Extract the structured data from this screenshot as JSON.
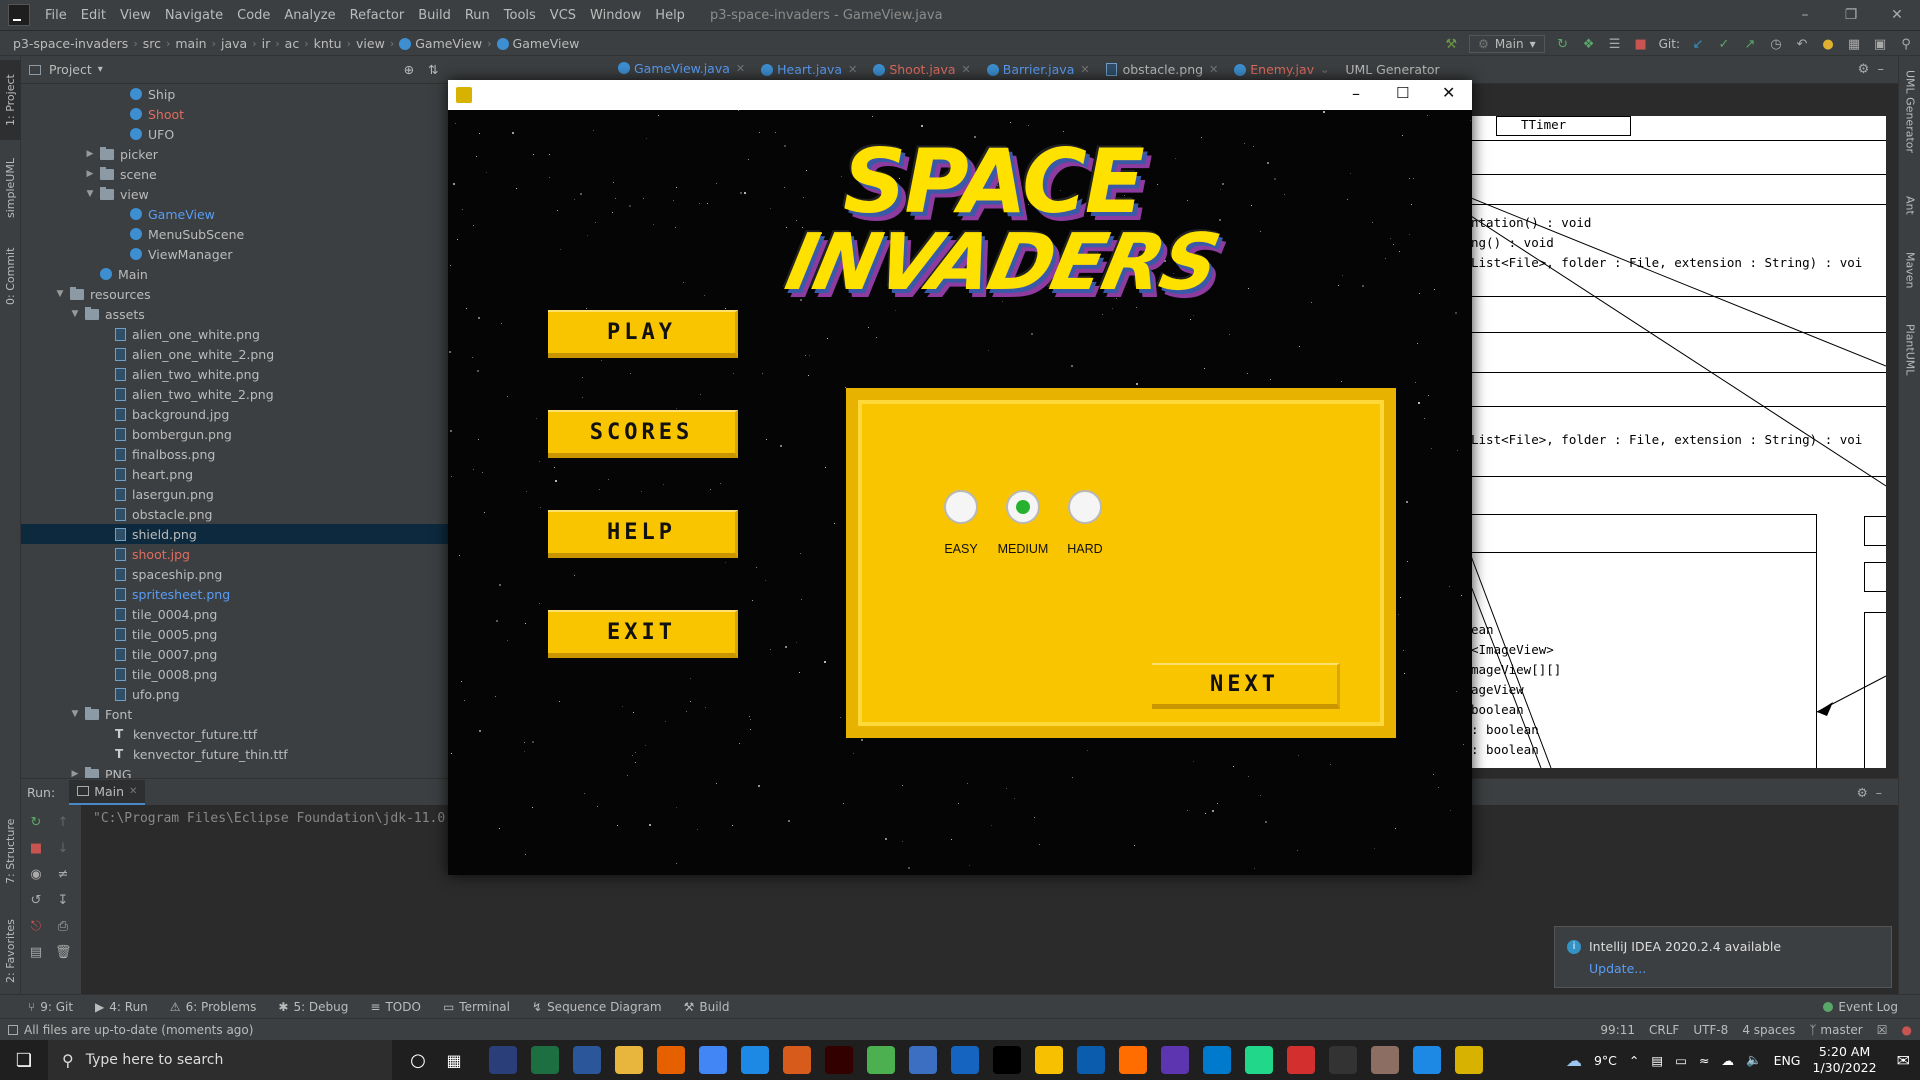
{
  "ide": {
    "menu": [
      "File",
      "Edit",
      "View",
      "Navigate",
      "Code",
      "Analyze",
      "Refactor",
      "Build",
      "Run",
      "Tools",
      "VCS",
      "Window",
      "Help"
    ],
    "window_title": "p3-space-invaders - GameView.java",
    "breadcrumbs": [
      "p3-space-invaders",
      "src",
      "main",
      "java",
      "ir",
      "ac",
      "kntu",
      "view",
      "GameView",
      "GameView"
    ],
    "run_config": "Main",
    "git_label": "Git:",
    "project_view": "Project",
    "tabs": [
      {
        "label": "GameView.java",
        "color": "#589df6"
      },
      {
        "label": "Heart.java",
        "color": "#589df6"
      },
      {
        "label": "Shoot.java",
        "color": "#e06c5f"
      },
      {
        "label": "Barrier.java",
        "color": "#589df6"
      },
      {
        "label": "obstacle.png",
        "color": "#bbbbbb"
      },
      {
        "label": "Enemy.jav",
        "color": "#e06c5f"
      },
      {
        "label": "UML Generator",
        "color": "#bbbbbb"
      }
    ],
    "left_tabs": [
      "1: Project",
      "simpleUML",
      "0: Commit",
      "7: Structure",
      "2: Favorites"
    ],
    "right_tabs": [
      "UML Generator",
      "Ant",
      "Maven",
      "PlantUML"
    ],
    "tree": [
      {
        "label": "Ship",
        "indent": 7,
        "kind": "class"
      },
      {
        "label": "Shoot",
        "indent": 7,
        "kind": "class",
        "color": "red"
      },
      {
        "label": "UFO",
        "indent": 7,
        "kind": "class"
      },
      {
        "label": "picker",
        "indent": 5,
        "kind": "folder",
        "arrow": "▶"
      },
      {
        "label": "scene",
        "indent": 5,
        "kind": "folder",
        "arrow": "▶"
      },
      {
        "label": "view",
        "indent": 5,
        "kind": "folder",
        "arrow": "▼"
      },
      {
        "label": "GameView",
        "indent": 7,
        "kind": "class",
        "color": "blue"
      },
      {
        "label": "MenuSubScene",
        "indent": 7,
        "kind": "class"
      },
      {
        "label": "ViewManager",
        "indent": 7,
        "kind": "class"
      },
      {
        "label": "Main",
        "indent": 5,
        "kind": "class"
      },
      {
        "label": "resources",
        "indent": 3,
        "kind": "folder",
        "arrow": "▼"
      },
      {
        "label": "assets",
        "indent": 4,
        "kind": "folder",
        "arrow": "▼"
      },
      {
        "label": "alien_one_white.png",
        "indent": 6,
        "kind": "file"
      },
      {
        "label": "alien_one_white_2.png",
        "indent": 6,
        "kind": "file"
      },
      {
        "label": "alien_two_white.png",
        "indent": 6,
        "kind": "file"
      },
      {
        "label": "alien_two_white_2.png",
        "indent": 6,
        "kind": "file"
      },
      {
        "label": "background.jpg",
        "indent": 6,
        "kind": "file"
      },
      {
        "label": "bombergun.png",
        "indent": 6,
        "kind": "file"
      },
      {
        "label": "finalboss.png",
        "indent": 6,
        "kind": "file"
      },
      {
        "label": "heart.png",
        "indent": 6,
        "kind": "file"
      },
      {
        "label": "lasergun.png",
        "indent": 6,
        "kind": "file"
      },
      {
        "label": "obstacle.png",
        "indent": 6,
        "kind": "file"
      },
      {
        "label": "shield.png",
        "indent": 6,
        "kind": "file",
        "selected": true
      },
      {
        "label": "shoot.jpg",
        "indent": 6,
        "kind": "file",
        "color": "red"
      },
      {
        "label": "spaceship.png",
        "indent": 6,
        "kind": "file"
      },
      {
        "label": "spritesheet.png",
        "indent": 6,
        "kind": "file",
        "color": "blue"
      },
      {
        "label": "tile_0004.png",
        "indent": 6,
        "kind": "file"
      },
      {
        "label": "tile_0005.png",
        "indent": 6,
        "kind": "file"
      },
      {
        "label": "tile_0007.png",
        "indent": 6,
        "kind": "file"
      },
      {
        "label": "tile_0008.png",
        "indent": 6,
        "kind": "file"
      },
      {
        "label": "ufo.png",
        "indent": 6,
        "kind": "file"
      },
      {
        "label": "Font",
        "indent": 4,
        "kind": "folder",
        "arrow": "▼"
      },
      {
        "label": "kenvector_future.ttf",
        "indent": 6,
        "kind": "font"
      },
      {
        "label": "kenvector_future_thin.ttf",
        "indent": 6,
        "kind": "font"
      },
      {
        "label": "PNG",
        "indent": 4,
        "kind": "folder",
        "arrow": "▶"
      }
    ],
    "uml_lines": [
      "TTimer",
      "ntation() : void",
      "ng() : void",
      "List<File>, folder : File, extension : String) : voi",
      "List<File>, folder : File, extension : String) : voi",
      "ean",
      "<ImageView>",
      "mageView[][]",
      "ageView",
      " boolean",
      ": boolean",
      " : boolean"
    ],
    "run": {
      "label": "Run:",
      "tab": "Main",
      "command": "\"C:\\Program Files\\Eclipse Foundation\\jdk-11.0"
    },
    "bottom_tools": [
      "9: Git",
      "4: Run",
      "6: Problems",
      "5: Debug",
      "TODO",
      "Terminal",
      "Sequence Diagram",
      "Build"
    ],
    "event_log": "Event Log",
    "status_left": "All files are up-to-date (moments ago)",
    "status_right": [
      "99:11",
      "CRLF",
      "UTF-8",
      "4 spaces",
      "master"
    ],
    "notification": {
      "title": "IntelliJ IDEA 2020.2.4 available",
      "link": "Update..."
    }
  },
  "game": {
    "logo_line1": "SPACE",
    "logo_line2": "INVADERS",
    "buttons": [
      "PLAY",
      "SCORES",
      "HELP",
      "EXIT"
    ],
    "difficulty": [
      {
        "label": "EASY",
        "selected": false
      },
      {
        "label": "MEDIUM",
        "selected": true
      },
      {
        "label": "HARD",
        "selected": false
      }
    ],
    "next_label": "NEXT"
  },
  "taskbar": {
    "search_placeholder": "Type here to search",
    "weather": "9°C",
    "lang": "ENG",
    "time": "5:20 AM",
    "date": "1/30/2022"
  }
}
